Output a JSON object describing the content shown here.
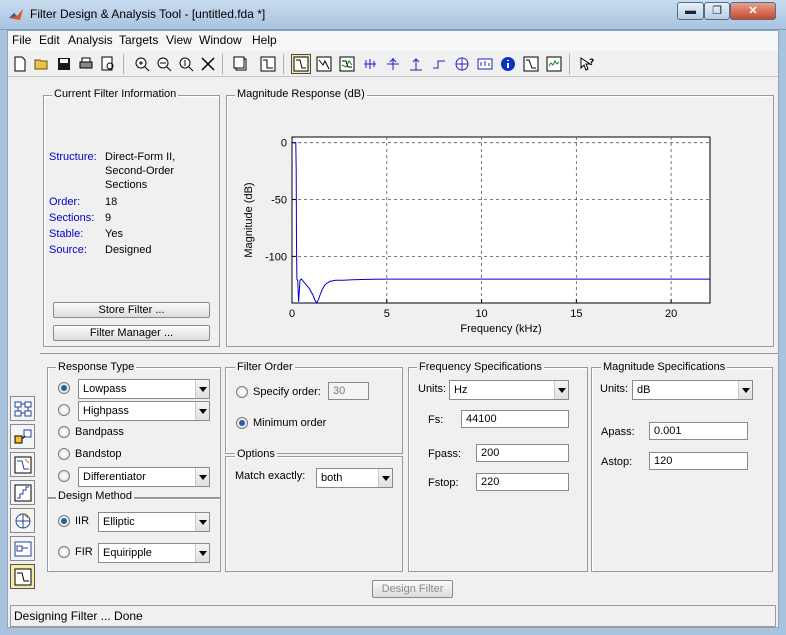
{
  "window": {
    "title": "Filter Design & Analysis Tool -  [untitled.fda *]",
    "min_label": "▬",
    "max_label": "❐",
    "close_label": "✕"
  },
  "menu": [
    "File",
    "Edit",
    "Analysis",
    "Targets",
    "View",
    "Window",
    "Help"
  ],
  "current_filter": {
    "title": "Current Filter Information",
    "rows": [
      {
        "label": "Structure:",
        "value": "Direct-Form II,"
      },
      {
        "label": "",
        "value": "Second-Order"
      },
      {
        "label": "",
        "value": "Sections"
      },
      {
        "label": "Order:",
        "value": "18"
      },
      {
        "label": "Sections:",
        "value": "9"
      },
      {
        "label": "Stable:",
        "value": "Yes"
      },
      {
        "label": "Source:",
        "value": "Designed"
      }
    ],
    "store_button": "Store Filter ...",
    "manager_button": "Filter Manager ..."
  },
  "magnitude_panel": {
    "title": "Magnitude Response (dB)"
  },
  "chart_data": {
    "type": "line",
    "title": "",
    "xlabel": "Frequency (kHz)",
    "ylabel": "Magnitude (dB)",
    "xlim": [
      0,
      22.05
    ],
    "ylim": [
      -141,
      5
    ],
    "xticks": [
      0,
      5,
      10,
      15,
      20
    ],
    "yticks": [
      0,
      -50,
      -100
    ],
    "grid": true,
    "series": [
      {
        "x": [
          0,
          0.2,
          0.22,
          0.24,
          0.26,
          0.3,
          0.35,
          0.42,
          0.5,
          0.6,
          0.7,
          0.8,
          0.9,
          1.0,
          1.1,
          1.2,
          1.3,
          1.4,
          1.5,
          1.6,
          1.7,
          1.8,
          2.0,
          2.3,
          2.7,
          3.2,
          4.0,
          5.0,
          7.0,
          10.0,
          15.0,
          20.0,
          22.05
        ],
        "y": [
          0,
          0,
          -25,
          -90,
          -120,
          -121,
          -140,
          -121,
          -120,
          -122,
          -124,
          -126,
          -128,
          -131,
          -134,
          -138,
          -141,
          -138,
          -133,
          -129,
          -126,
          -124,
          -122,
          -121,
          -121,
          -120.5,
          -120.2,
          -120,
          -120,
          -120,
          -120,
          -120,
          -120
        ]
      }
    ]
  },
  "response_type": {
    "title": "Response Type",
    "lowpass": "Lowpass",
    "highpass": "Highpass",
    "bandpass": "Bandpass",
    "bandstop": "Bandstop",
    "differentiator": "Differentiator"
  },
  "design_method": {
    "title": "Design Method",
    "iir_label": "IIR",
    "iir_value": "Elliptic",
    "fir_label": "FIR",
    "fir_value": "Equiripple"
  },
  "filter_order": {
    "title": "Filter Order",
    "specify_label": "Specify order:",
    "specify_value": "30",
    "minimum_label": "Minimum order"
  },
  "options": {
    "title": "Options",
    "match_label": "Match exactly:",
    "match_value": "both"
  },
  "frequency_specs": {
    "title": "Frequency Specifications",
    "units_label": "Units:",
    "units_value": "Hz",
    "fs_label": "Fs:",
    "fs_value": "44100",
    "fpass_label": "Fpass:",
    "fpass_value": "200",
    "fstop_label": "Fstop:",
    "fstop_value": "220"
  },
  "magnitude_specs": {
    "title": "Magnitude Specifications",
    "units_label": "Units:",
    "units_value": "dB",
    "apass_label": "Apass:",
    "apass_value": "0.001",
    "astop_label": "Astop:",
    "astop_value": "120"
  },
  "design_button": "Design Filter",
  "status": "Designing Filter ... Done",
  "colors": {
    "plot_line": "#0000cc",
    "label_blue": "#0000cc"
  }
}
